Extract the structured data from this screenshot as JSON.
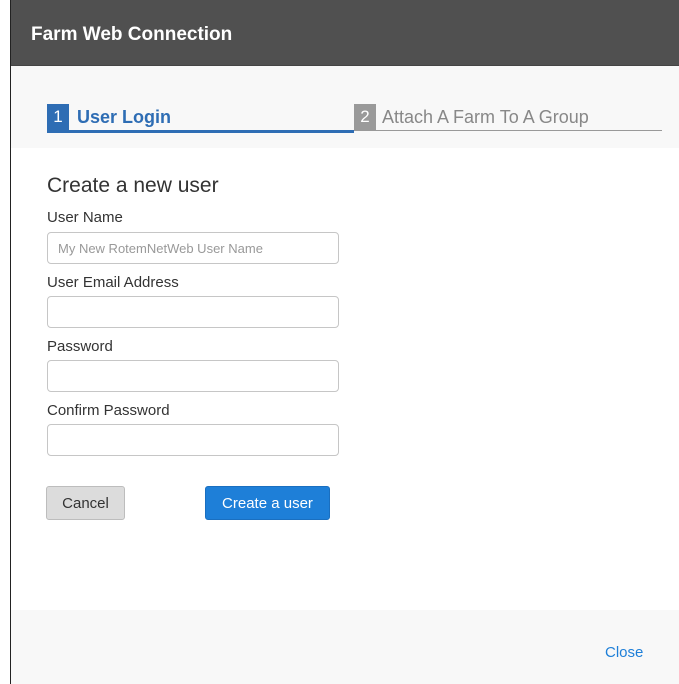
{
  "dialog": {
    "title": "Farm Web Connection",
    "close_label": "Close"
  },
  "wizard": {
    "steps": [
      {
        "number": "1",
        "label": "User Login",
        "active": true
      },
      {
        "number": "2",
        "label": "Attach A Farm To A Group",
        "active": false
      }
    ]
  },
  "form": {
    "title": "Create a new user",
    "user_name": {
      "label": "User Name",
      "value": "",
      "placeholder": "My New RotemNetWeb User Name"
    },
    "email": {
      "label": "User Email Address",
      "value": "",
      "placeholder": ""
    },
    "password": {
      "label": "Password",
      "value": "",
      "placeholder": ""
    },
    "confirm_password": {
      "label": "Confirm Password",
      "value": "",
      "placeholder": ""
    },
    "cancel_label": "Cancel",
    "create_label": "Create a user"
  },
  "colors": {
    "titlebar": "#505050",
    "accent": "#2e6db4",
    "primary_button": "#1e7fd8",
    "inactive_step": "#9a9a9a"
  }
}
